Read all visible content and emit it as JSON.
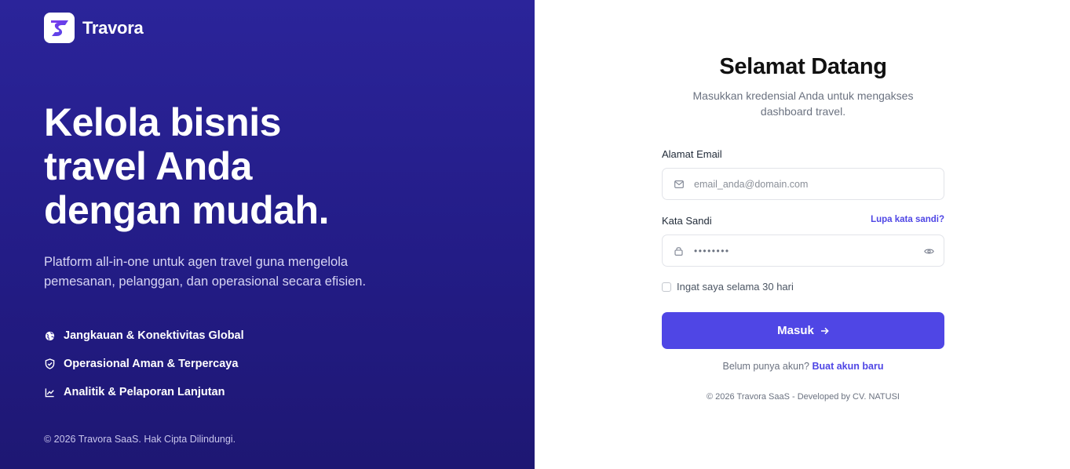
{
  "brand": {
    "name": "Travora",
    "logo_icon": "travora-s-logo-icon",
    "logo_colors": [
      "#4f46e5",
      "#7c3aed"
    ]
  },
  "hero": {
    "headline_lines": [
      "Kelola bisnis",
      "travel Anda",
      "dengan mudah."
    ],
    "subtext": "Platform all-in-one untuk agen travel guna mengelola pemesanan, pelanggan, dan operasional secara efisien."
  },
  "features": [
    {
      "icon": "globe-icon",
      "label": "Jangkauan & Konektivitas Global"
    },
    {
      "icon": "shield-check-icon",
      "label": "Operasional Aman & Terpercaya"
    },
    {
      "icon": "chart-line-icon",
      "label": "Analitik & Pelaporan Lanjutan"
    }
  ],
  "left_footer": "© 2026 Travora SaaS. Hak Cipta Dilindungi.",
  "login": {
    "title": "Selamat Datang",
    "description": "Masukkan kredensial Anda untuk mengakses dashboard travel.",
    "email": {
      "label": "Alamat Email",
      "placeholder": "email_anda@domain.com",
      "value": "",
      "icon": "mail-icon"
    },
    "password": {
      "label": "Kata Sandi",
      "value_masked": "••••••••",
      "icon": "lock-icon",
      "toggle_icon": "eye-icon"
    },
    "forgot_link": "Lupa kata sandi?",
    "remember_label": "Ingat saya selama 30 hari",
    "remember_checked": false,
    "submit_label": "Masuk",
    "signup_prompt": "Belum punya akun?",
    "signup_link": "Buat akun baru",
    "footer": "© 2026 Travora SaaS - Developed by CV. NATUSI"
  },
  "colors": {
    "panel_bg": "#2b249a",
    "accent": "#4f46e5",
    "text_dark": "#111111",
    "text_muted": "#6b7280"
  }
}
